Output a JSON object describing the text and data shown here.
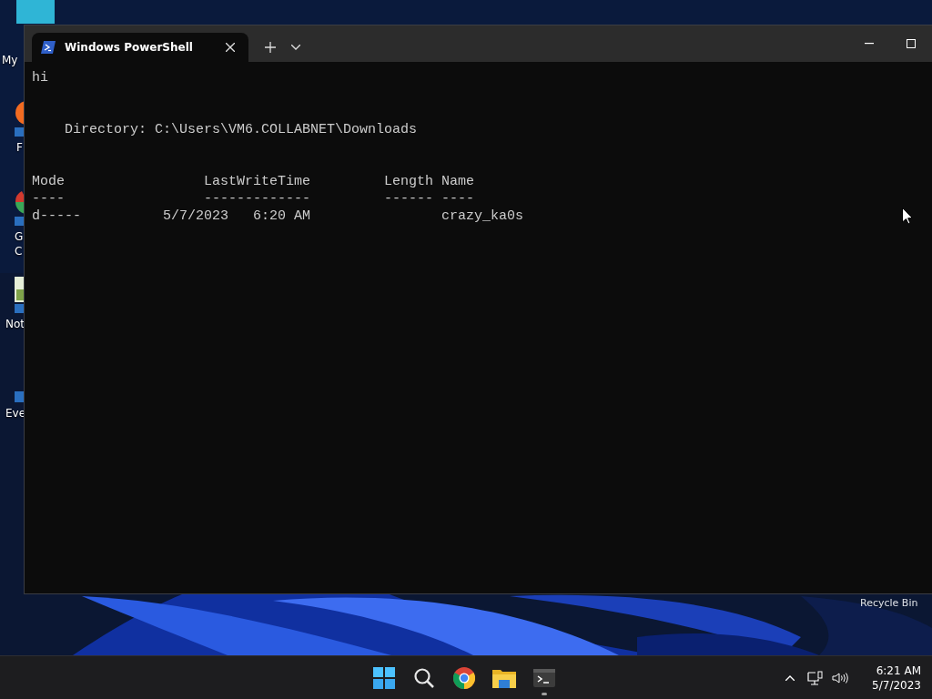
{
  "desktop": {
    "icons": [
      {
        "kind": "pc",
        "lines": [
          "My"
        ]
      },
      {
        "kind": "firefox",
        "lines": [
          "F"
        ]
      },
      {
        "kind": "chrome",
        "lines": [
          "G",
          "C"
        ]
      },
      {
        "kind": "notepad",
        "lines": [
          "Not"
        ]
      },
      {
        "kind": "app",
        "lines": [
          "Eve"
        ]
      }
    ],
    "recycle_bin": "Recycle Bin"
  },
  "window": {
    "tab": {
      "title": "Windows PowerShell",
      "selected": true
    },
    "output": [
      "hi"
    ],
    "directory": "Directory: C:\\Users\\VM6.COLLABNET\\Downloads",
    "table": {
      "columns": [
        "Mode",
        "LastWriteTime",
        "Length",
        "Name"
      ],
      "underlines": [
        "----",
        "-------------",
        "------",
        "----"
      ],
      "rows": [
        {
          "mode": "d-----",
          "last_write_time": "5/7/2023   6:20 AM",
          "name": "crazy_ka0s"
        }
      ]
    }
  },
  "taskbar": {
    "apps": [
      {
        "kind": "start",
        "running": false
      },
      {
        "kind": "search",
        "running": false
      },
      {
        "kind": "chrome",
        "running": false
      },
      {
        "kind": "explorer",
        "running": false
      },
      {
        "kind": "terminal",
        "running": true
      }
    ],
    "tray": {
      "time": "6:21 AM",
      "date": "5/7/2023"
    }
  }
}
